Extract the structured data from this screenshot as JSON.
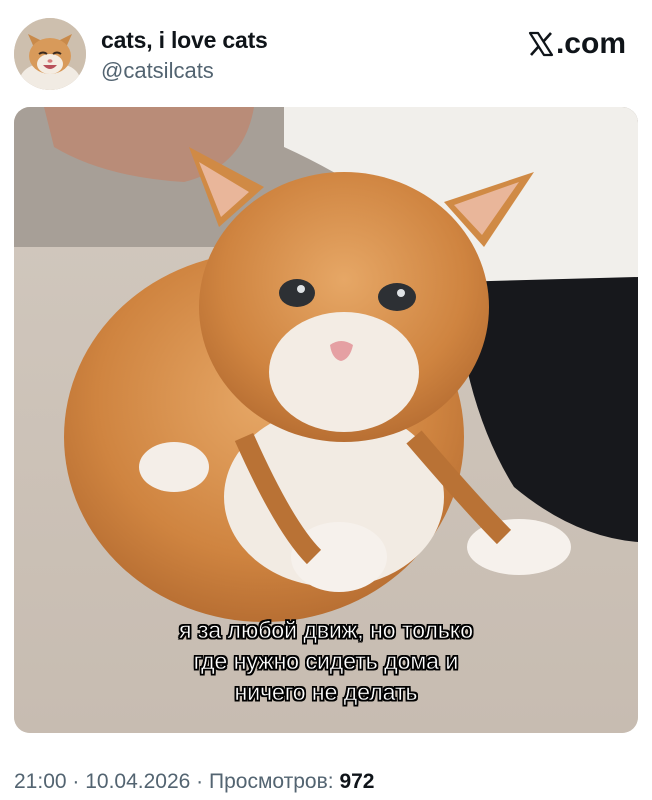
{
  "post": {
    "author": {
      "display_name": "cats, i love cats",
      "handle": "@catsilcats",
      "avatar": "smiling-cat-avatar"
    },
    "brand": {
      "icon": "x-logo-icon",
      "domain": ".com"
    },
    "media": {
      "description_icon": "kitten-photo",
      "caption_lines": [
        "я за любой движ, но только",
        "где нужно сидеть дома и",
        "ничего не делать"
      ]
    },
    "meta": {
      "time": "21:00",
      "separator": " · ",
      "date": "10.04.2026",
      "views_label": "Просмотров: ",
      "views_count": "972"
    }
  },
  "colors": {
    "text_primary": "#0f1419",
    "text_secondary": "#536471",
    "kitten_orange": "#d98a3e",
    "carpet": "#cfc6bc"
  }
}
